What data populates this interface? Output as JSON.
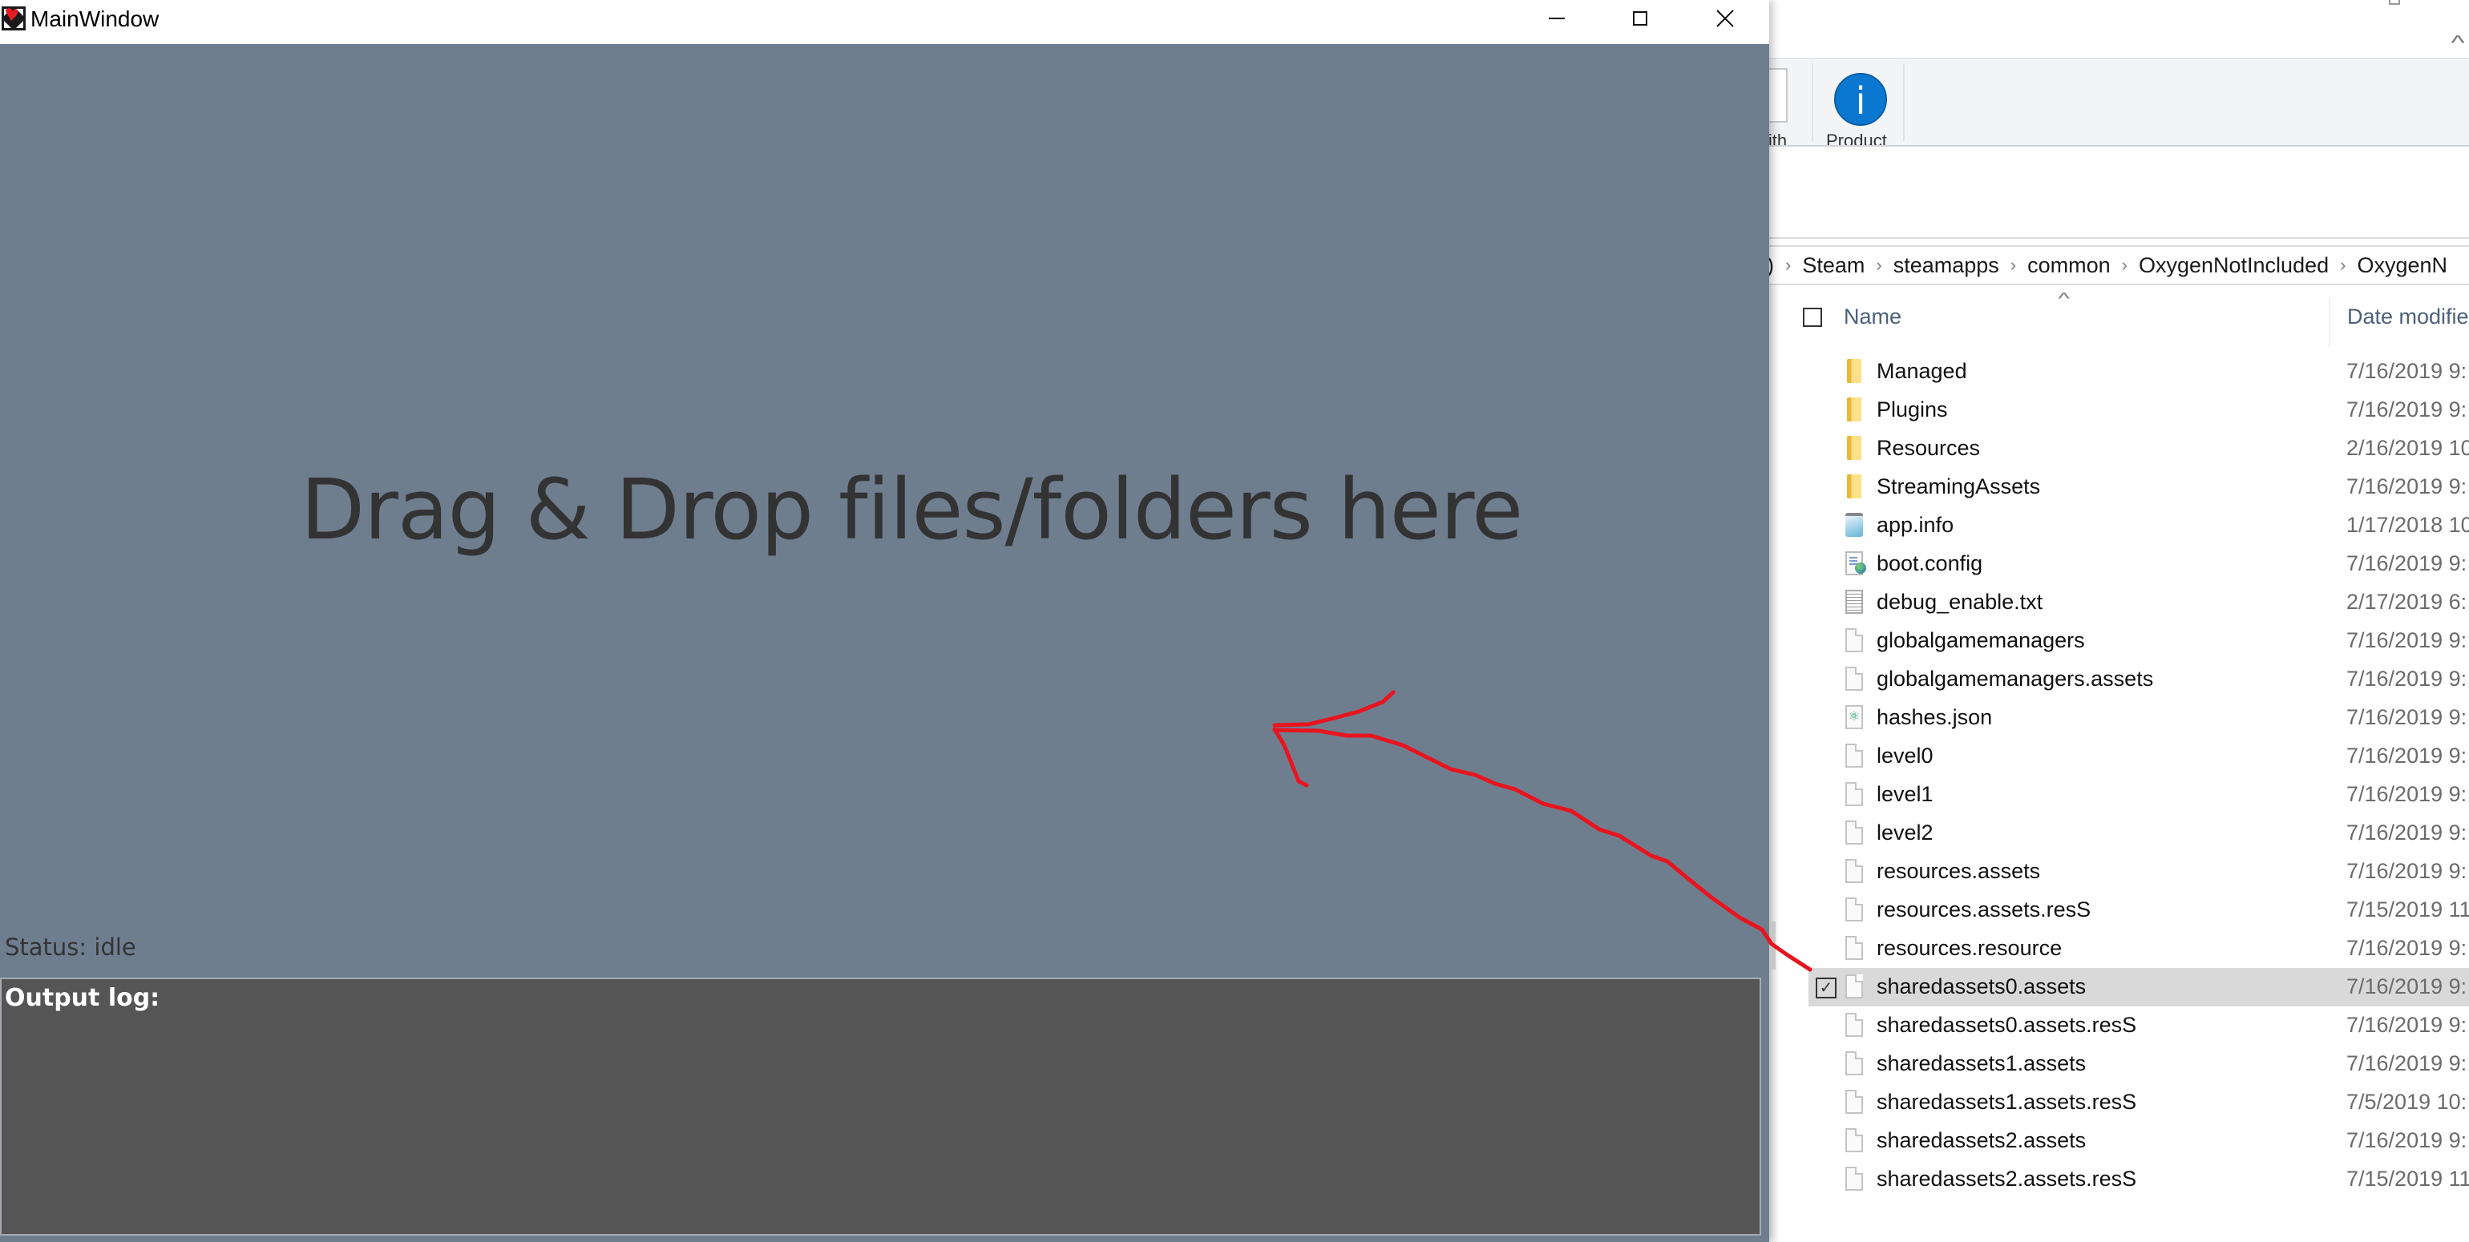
{
  "main_window": {
    "title": "MainWindow",
    "app_icon": "app-logo-icon",
    "controls": {
      "minimize": "minimize-icon",
      "maximize": "maximize-icon",
      "close": "close-icon"
    },
    "drop_zone_text": "Drag & Drop files/folders here",
    "status_text": "Status: idle",
    "output_log_label": "Output log:",
    "output_log_content": "",
    "colors": {
      "background": "#6f7e8f",
      "log_background": "#555555",
      "text": "#333333"
    }
  },
  "annotation": {
    "type": "red-hand-drawn-arrow",
    "color": "#e8141e",
    "from": "sharedassets0.assets",
    "to": "drop-zone"
  },
  "explorer": {
    "ribbon": {
      "buttons": [
        {
          "label": "with",
          "icon": "open-with-icon"
        },
        {
          "label": "Product",
          "icon": "info-icon"
        }
      ]
    },
    "breadcrumb": [
      "Steam",
      "steamapps",
      "common",
      "OxygenNotIncluded",
      "OxygenN"
    ],
    "breadcrumb_leading": ")",
    "columns": {
      "name": "Name",
      "date_modified": "Date modifie"
    },
    "files": [
      {
        "name": "Managed",
        "date": "7/16/2019 9:",
        "type": "folder"
      },
      {
        "name": "Plugins",
        "date": "7/16/2019 9:",
        "type": "folder"
      },
      {
        "name": "Resources",
        "date": "2/16/2019 10",
        "type": "folder"
      },
      {
        "name": "StreamingAssets",
        "date": "7/16/2019 9:",
        "type": "folder"
      },
      {
        "name": "app.info",
        "date": "1/17/2018 10",
        "type": "notepad"
      },
      {
        "name": "boot.config",
        "date": "7/16/2019 9:",
        "type": "config"
      },
      {
        "name": "debug_enable.txt",
        "date": "2/17/2019 6:",
        "type": "text"
      },
      {
        "name": "globalgamemanagers",
        "date": "7/16/2019 9:",
        "type": "file"
      },
      {
        "name": "globalgamemanagers.assets",
        "date": "7/16/2019 9:",
        "type": "file"
      },
      {
        "name": "hashes.json",
        "date": "7/16/2019 9:",
        "type": "json"
      },
      {
        "name": "level0",
        "date": "7/16/2019 9:",
        "type": "file"
      },
      {
        "name": "level1",
        "date": "7/16/2019 9:",
        "type": "file"
      },
      {
        "name": "level2",
        "date": "7/16/2019 9:",
        "type": "file"
      },
      {
        "name": "resources.assets",
        "date": "7/16/2019 9:",
        "type": "file"
      },
      {
        "name": "resources.assets.resS",
        "date": "7/15/2019 11",
        "type": "file"
      },
      {
        "name": "resources.resource",
        "date": "7/16/2019 9:",
        "type": "file"
      },
      {
        "name": "sharedassets0.assets",
        "date": "7/16/2019 9:",
        "type": "file",
        "selected": true
      },
      {
        "name": "sharedassets0.assets.resS",
        "date": "7/16/2019 9:",
        "type": "file"
      },
      {
        "name": "sharedassets1.assets",
        "date": "7/16/2019 9:",
        "type": "file"
      },
      {
        "name": "sharedassets1.assets.resS",
        "date": "7/5/2019 10:",
        "type": "file"
      },
      {
        "name": "sharedassets2.assets",
        "date": "7/16/2019 9:",
        "type": "file"
      },
      {
        "name": "sharedassets2.assets.resS",
        "date": "7/15/2019 11",
        "type": "file"
      }
    ]
  }
}
